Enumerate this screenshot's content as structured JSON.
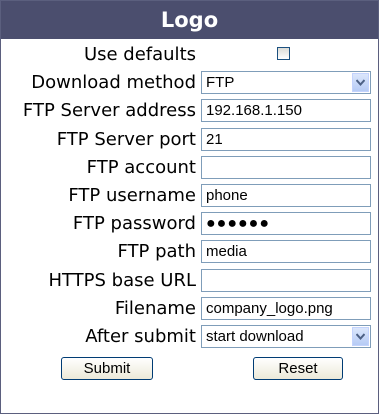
{
  "title": "Logo",
  "fields": {
    "use_defaults": {
      "label": "Use defaults",
      "checked": false
    },
    "download_method": {
      "label": "Download method",
      "value": "FTP",
      "options": [
        "FTP"
      ]
    },
    "ftp_server_address": {
      "label": "FTP Server address",
      "value": "192.168.1.150"
    },
    "ftp_server_port": {
      "label": "FTP Server port",
      "value": "21"
    },
    "ftp_account": {
      "label": "FTP account",
      "value": ""
    },
    "ftp_username": {
      "label": "FTP username",
      "value": "phone"
    },
    "ftp_password": {
      "label": "FTP password",
      "value": "●●●●●●"
    },
    "ftp_path": {
      "label": "FTP path",
      "value": "media"
    },
    "https_base_url": {
      "label": "HTTPS base URL",
      "value": ""
    },
    "filename": {
      "label": "Filename",
      "value": "company_logo.png"
    },
    "after_submit": {
      "label": "After submit",
      "value": "start download",
      "options": [
        "start download"
      ]
    }
  },
  "buttons": {
    "submit": "Submit",
    "reset": "Reset"
  },
  "colors": {
    "title_bar": "#4b4e6e",
    "border": "#7f9db9"
  },
  "icons": {
    "select_arrow": "chevron-down-icon"
  }
}
